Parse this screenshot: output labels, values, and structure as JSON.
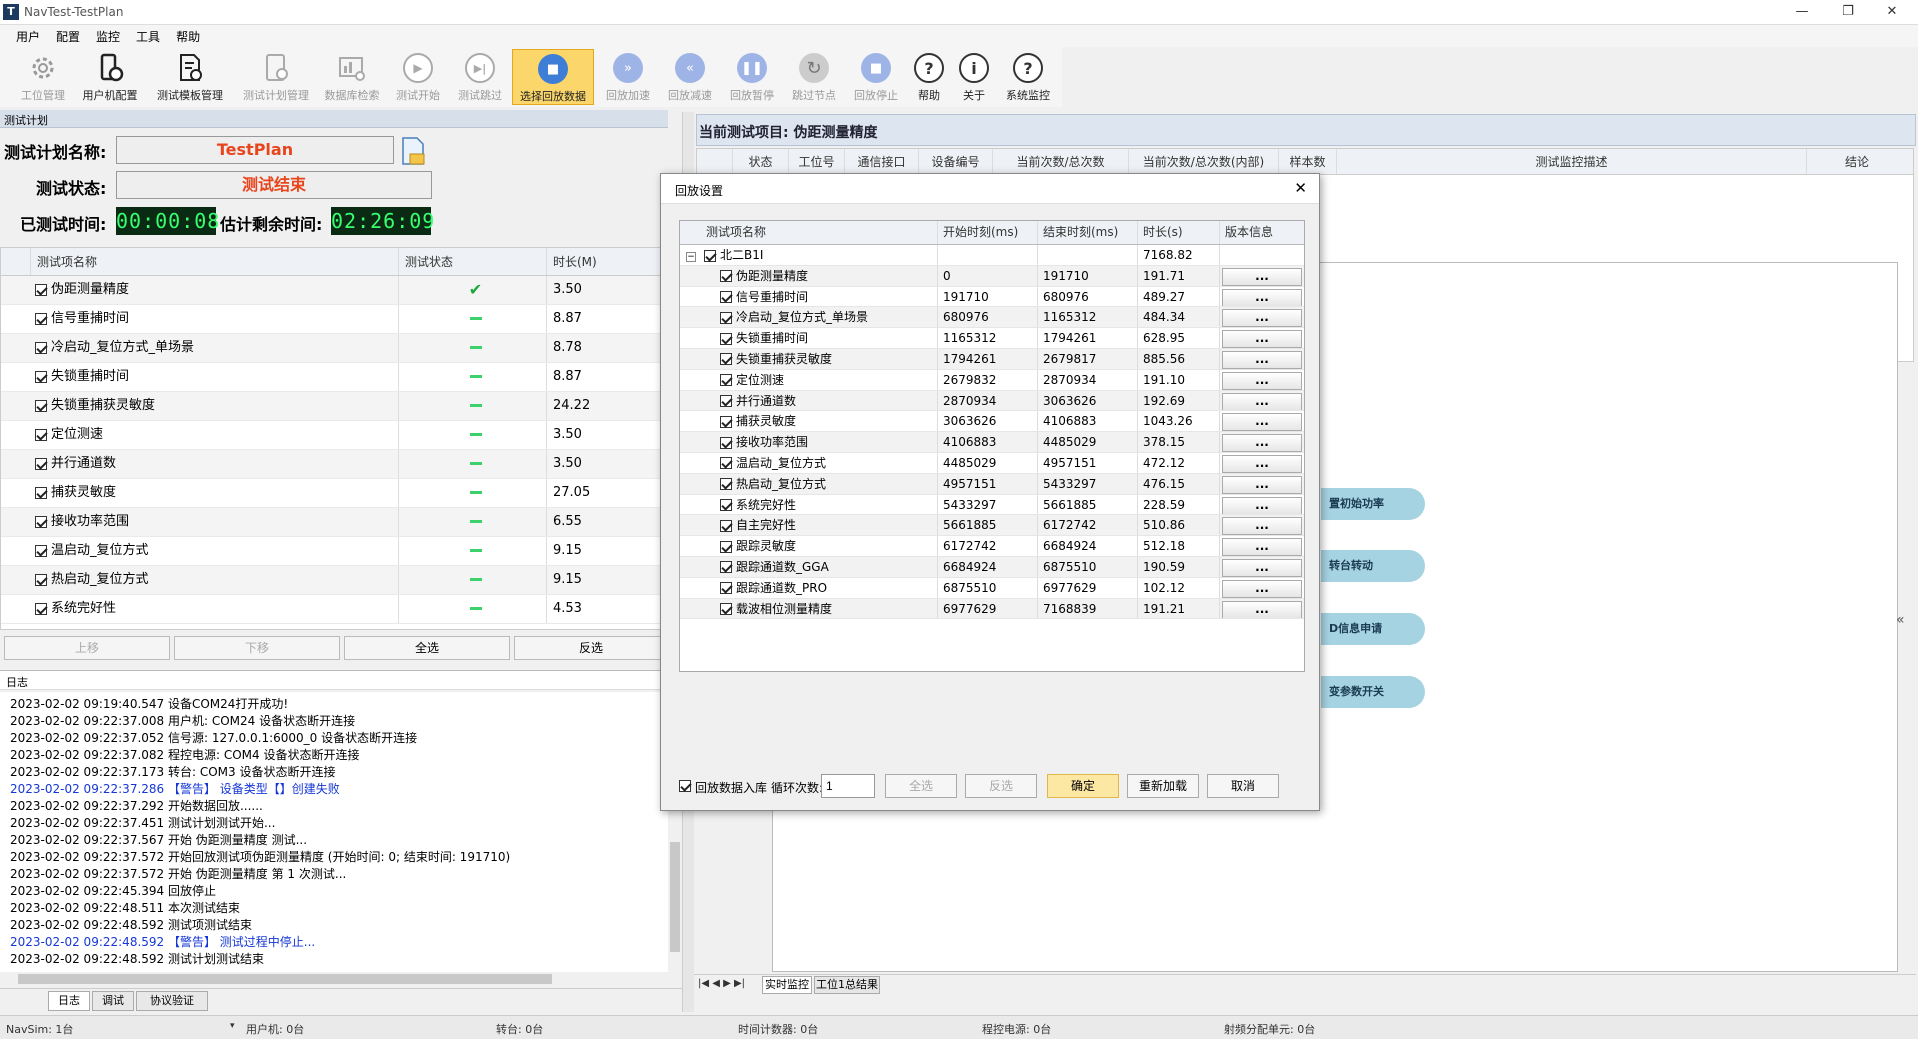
{
  "window": {
    "title": "NavTest-TestPlan",
    "icon": "T"
  },
  "menu": [
    "用户",
    "配置",
    "监控",
    "工具",
    "帮助"
  ],
  "toolbar": [
    {
      "label": "工位管理",
      "icon": "gear-icon",
      "state": "disabled"
    },
    {
      "label": "用户机配置",
      "icon": "device-gear-icon",
      "state": "enabled"
    },
    {
      "label": "测试模板管理",
      "icon": "document-gear-icon",
      "state": "enabled"
    },
    {
      "label": "测试计划管理",
      "icon": "plan-gear-icon",
      "state": "disabled"
    },
    {
      "label": "数据库检索",
      "icon": "chart-search-icon",
      "state": "disabled"
    },
    {
      "label": "测试开始",
      "icon": "play-icon",
      "state": "disabled"
    },
    {
      "label": "测试跳过",
      "icon": "skip-icon",
      "state": "disabled"
    },
    {
      "label": "选择回放数据",
      "icon": "replay-data-icon",
      "state": "selected"
    },
    {
      "label": "回放加速",
      "icon": "fast-forward-icon",
      "state": "disabled"
    },
    {
      "label": "回放减速",
      "icon": "rewind-icon",
      "state": "disabled"
    },
    {
      "label": "回放暂停",
      "icon": "pause-icon",
      "state": "disabled"
    },
    {
      "label": "跳过节点",
      "icon": "refresh-icon",
      "state": "disabled"
    },
    {
      "label": "回放停止",
      "icon": "stop-icon",
      "state": "disabled"
    },
    {
      "label": "帮助",
      "icon": "help-icon",
      "state": "enabled"
    },
    {
      "label": "关于",
      "icon": "info-icon",
      "state": "enabled"
    },
    {
      "label": "系统监控",
      "icon": "help-icon",
      "state": "enabled"
    }
  ],
  "test_plan": {
    "panel_title": "测试计划",
    "name_label": "测试计划名称:",
    "name_value": "TestPlan",
    "status_label": "测试状态:",
    "status_value": "测试结束",
    "elapsed_label": "已测试时间:",
    "elapsed_value": "00:00:08",
    "remaining_label": "估计剩余时间:",
    "remaining_value": "02:26:09",
    "columns": [
      "测试项名称",
      "测试状态",
      "时长(M)"
    ],
    "rows": [
      {
        "name": "伪距测量精度",
        "status": "done",
        "duration": "3.50"
      },
      {
        "name": "信号重捕时间",
        "status": "pending",
        "duration": "8.87"
      },
      {
        "name": "冷启动_复位方式_单场景",
        "status": "pending",
        "duration": "8.78"
      },
      {
        "name": "失锁重捕时间",
        "status": "pending",
        "duration": "8.87"
      },
      {
        "name": "失锁重捕获灵敏度",
        "status": "pending",
        "duration": "24.22"
      },
      {
        "name": "定位测速",
        "status": "pending",
        "duration": "3.50"
      },
      {
        "name": "并行通道数",
        "status": "pending",
        "duration": "3.50"
      },
      {
        "name": "捕获灵敏度",
        "status": "pending",
        "duration": "27.05"
      },
      {
        "name": "接收功率范围",
        "status": "pending",
        "duration": "6.55"
      },
      {
        "name": "温启动_复位方式",
        "status": "pending",
        "duration": "9.15"
      },
      {
        "name": "热启动_复位方式",
        "status": "pending",
        "duration": "9.15"
      },
      {
        "name": "系统完好性",
        "status": "pending",
        "duration": "4.53"
      }
    ],
    "buttons": {
      "up": "上移",
      "down": "下移",
      "select_all": "全选",
      "invert": "反选"
    }
  },
  "log": {
    "panel_title": "日志",
    "lines": [
      {
        "text": "2023-02-02 09:19:40.547 设备COM24打开成功!",
        "warn": false
      },
      {
        "text": "2023-02-02 09:22:37.008 用户机: COM24 设备状态断开连接",
        "warn": false
      },
      {
        "text": "2023-02-02 09:22:37.052 信号源: 127.0.0.1:6000_0 设备状态断开连接",
        "warn": false
      },
      {
        "text": "2023-02-02 09:22:37.082 程控电源: COM4 设备状态断开连接",
        "warn": false
      },
      {
        "text": "2023-02-02 09:22:37.173 转台: COM3 设备状态断开连接",
        "warn": false
      },
      {
        "text": "2023-02-02 09:22:37.286 【警告】 设备类型【】创建失败",
        "warn": true
      },
      {
        "text": "2023-02-02 09:22:37.292 开始数据回放......",
        "warn": false
      },
      {
        "text": "2023-02-02 09:22:37.451 测试计划测试开始...",
        "warn": false
      },
      {
        "text": "2023-02-02 09:22:37.567 开始 伪距测量精度 测试...",
        "warn": false
      },
      {
        "text": "2023-02-02 09:22:37.572 开始回放测试项伪距测量精度 (开始时间: 0; 结束时间: 191710)",
        "warn": false
      },
      {
        "text": "2023-02-02 09:22:37.572 开始 伪距测量精度 第 1 次测试...",
        "warn": false
      },
      {
        "text": "2023-02-02 09:22:45.394 回放停止",
        "warn": false
      },
      {
        "text": "2023-02-02 09:22:48.511 本次测试结束",
        "warn": false
      },
      {
        "text": "2023-02-02 09:22:48.592 测试项测试结束",
        "warn": false
      },
      {
        "text": "2023-02-02 09:22:48.592 【警告】 测试过程中停止...",
        "warn": true
      },
      {
        "text": "2023-02-02 09:22:48.592 测试计划测试结束",
        "warn": false
      }
    ],
    "tabs": [
      "日志",
      "调试",
      "协议验证"
    ]
  },
  "current_item": {
    "title": "当前测试项目: 伪距测量精度",
    "columns": [
      "状态",
      "工位号",
      "通信接口",
      "设备编号",
      "当前次数/总次数",
      "当前次数/总次数(内部)",
      "样本数",
      "测试监控描述",
      "结论"
    ],
    "flow_nodes": [
      "置初始功率",
      "转台转动",
      "D信息申请",
      "变参数开关"
    ],
    "tabs": [
      "实时监控",
      "工位1总结果"
    ]
  },
  "replay_dialog": {
    "title": "回放设置",
    "columns": [
      "测试项名称",
      "开始时刻(ms)",
      "结束时刻(ms)",
      "时长(s)",
      "版本信息"
    ],
    "group": {
      "name": "北二B1I",
      "duration": "7168.82"
    },
    "version_button": "...",
    "rows": [
      {
        "name": "伪距测量精度",
        "start": "0",
        "end": "191710",
        "duration": "191.71"
      },
      {
        "name": "信号重捕时间",
        "start": "191710",
        "end": "680976",
        "duration": "489.27"
      },
      {
        "name": "冷启动_复位方式_单场景",
        "start": "680976",
        "end": "1165312",
        "duration": "484.34"
      },
      {
        "name": "失锁重捕时间",
        "start": "1165312",
        "end": "1794261",
        "duration": "628.95"
      },
      {
        "name": "失锁重捕获灵敏度",
        "start": "1794261",
        "end": "2679817",
        "duration": "885.56"
      },
      {
        "name": "定位测速",
        "start": "2679832",
        "end": "2870934",
        "duration": "191.10"
      },
      {
        "name": "并行通道数",
        "start": "2870934",
        "end": "3063626",
        "duration": "192.69"
      },
      {
        "name": "捕获灵敏度",
        "start": "3063626",
        "end": "4106883",
        "duration": "1043.26"
      },
      {
        "name": "接收功率范围",
        "start": "4106883",
        "end": "4485029",
        "duration": "378.15"
      },
      {
        "name": "温启动_复位方式",
        "start": "4485029",
        "end": "4957151",
        "duration": "472.12"
      },
      {
        "name": "热启动_复位方式",
        "start": "4957151",
        "end": "5433297",
        "duration": "476.15"
      },
      {
        "name": "系统完好性",
        "start": "5433297",
        "end": "5661885",
        "duration": "228.59"
      },
      {
        "name": "自主完好性",
        "start": "5661885",
        "end": "6172742",
        "duration": "510.86"
      },
      {
        "name": "跟踪灵敏度",
        "start": "6172742",
        "end": "6684924",
        "duration": "512.18"
      },
      {
        "name": "跟踪通道数_GGA",
        "start": "6684924",
        "end": "6875510",
        "duration": "190.59"
      },
      {
        "name": "跟踪通道数_PRO",
        "start": "6875510",
        "end": "6977629",
        "duration": "102.12"
      },
      {
        "name": "载波相位测量精度",
        "start": "6977629",
        "end": "7168839",
        "duration": "191.21"
      }
    ],
    "import_label": "回放数据入库",
    "loop_label": "循环次数:",
    "loop_value": "1",
    "buttons": {
      "select_all": "全选",
      "invert": "反选",
      "ok": "确定",
      "reload": "重新加载",
      "cancel": "取消"
    }
  },
  "status_bar": [
    "NavSim: 1台",
    "用户机: 0台",
    "转台: 0台",
    "时间计数器: 0台",
    "程控电源: 0台",
    "射频分配单元: 0台"
  ],
  "colors": {
    "accent": "#3f7ed6",
    "selected_tool": "#fbd66a",
    "status_text": "#e8451d",
    "lcd_text": "#37ff6e",
    "warn_log": "#1537d6"
  }
}
